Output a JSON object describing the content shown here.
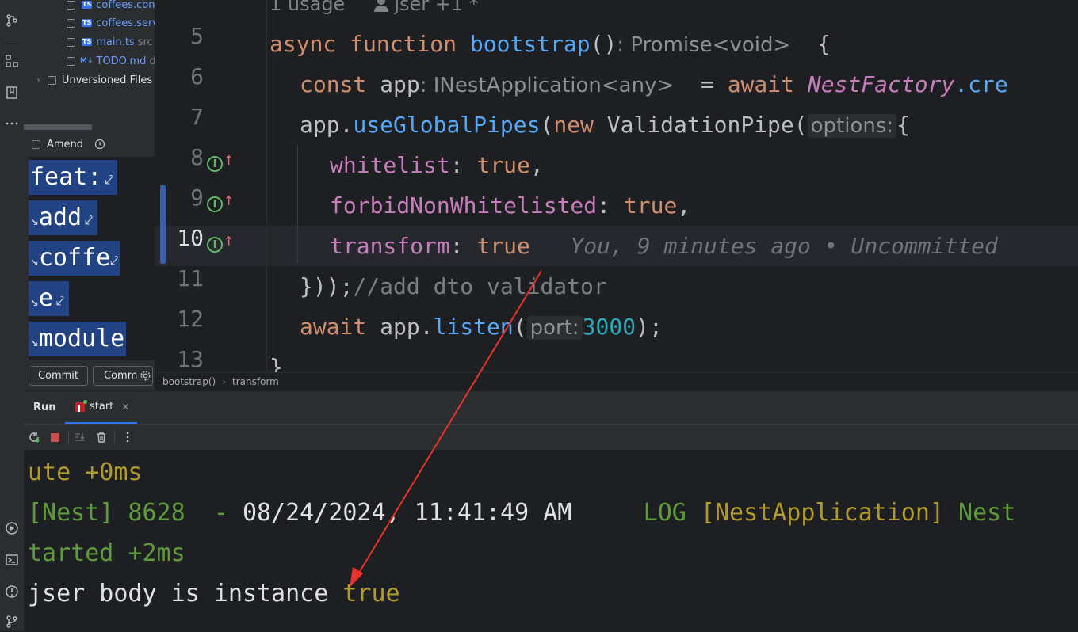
{
  "commit_panel": {
    "files": [
      {
        "badge": "TS",
        "name": "coffees.con",
        "dir": ""
      },
      {
        "badge": "TS",
        "name": "coffees.serv",
        "dir": ""
      },
      {
        "badge": "TS",
        "name": "main.ts",
        "dir": "src"
      },
      {
        "badge": "M↓",
        "name": "TODO.md",
        "dir": "d"
      }
    ],
    "unversioned_label": "Unversioned Files",
    "amend_label": "Amend",
    "message_lines": [
      "feat:",
      "add",
      "coffe",
      "e",
      "module"
    ],
    "commit_button": "Commit",
    "commit_push_button": "Comm"
  },
  "editor": {
    "usage_hint": "1 usage",
    "author_hint": "jser +1 *",
    "line_numbers": [
      "5",
      "6",
      "7",
      "8",
      "9",
      "10",
      "11",
      "12",
      "13"
    ],
    "lines": {
      "l5": {
        "kw1": "async",
        "kw2": "function",
        "fn": "bootstrap",
        "paren": "()",
        "type_hint": ": Promise<void>",
        "brace": "{"
      },
      "l6": {
        "kw": "const",
        "var": "app",
        "type_hint": ": INestApplication<any>",
        "eq": "=",
        "await": "await",
        "cls": "NestFactory",
        "rest": ".cre"
      },
      "l7": {
        "obj": "app.",
        "method": "useGlobalPipes",
        "open": "(",
        "new_kw": "new",
        "cls": "ValidationPipe(",
        "param_hint": "options:",
        "brace": "{"
      },
      "l8": {
        "prop": "whitelist",
        "colon": ":",
        "value": "true",
        "comma": ","
      },
      "l9": {
        "prop": "forbidNonWhitelisted",
        "colon": ":",
        "value": "true",
        "comma": ","
      },
      "l10": {
        "prop": "transform",
        "colon": ":",
        "value": "true",
        "blame": "You, 9 minutes ago • Uncommitted"
      },
      "l11": {
        "code": "}));",
        "comment": "//add dto validator"
      },
      "l12": {
        "await": "await",
        "obj": "app.",
        "method": "listen",
        "open": "(",
        "param_hint": "port:",
        "num": "3000",
        "close": ");"
      },
      "l13": {
        "code": "}"
      }
    }
  },
  "breadcrumb": [
    "bootstrap()",
    "transform"
  ],
  "run_panel": {
    "tab_run": "Run",
    "tab_start": "start"
  },
  "console": {
    "line1": {
      "text": "ute +0ms"
    },
    "line2": {
      "prefix": "[Nest] 8628  -",
      "date": "08/24/2024, 11:41:49 AM",
      "level": "LOG",
      "context": "[NestApplication]",
      "msg": "Nest"
    },
    "line3": {
      "text": "tarted +2ms"
    },
    "line4": {
      "text": "jser body is instance",
      "value": "true"
    }
  },
  "colors": {
    "accent": "#3574f0",
    "selection": "#214283",
    "annotation_arrow": "#e8322b"
  }
}
